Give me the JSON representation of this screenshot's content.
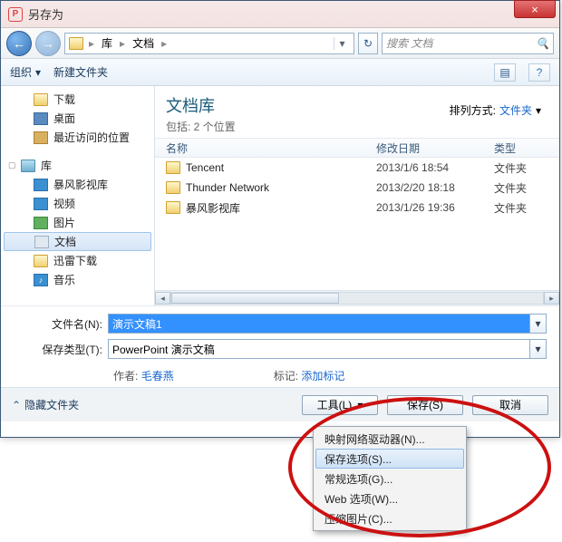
{
  "title": "另存为",
  "close_x": "×",
  "nav": {
    "back": "←",
    "fwd": "→",
    "crumb_lib": "库",
    "crumb_doc": "文档",
    "sep": "▸",
    "refresh": "↻"
  },
  "search": {
    "placeholder": "搜索 文档"
  },
  "toolbar": {
    "organize": "组织",
    "newfolder": "新建文件夹"
  },
  "side": {
    "downloads": "下载",
    "desktop": "桌面",
    "recent": "最近访问的位置",
    "library": "库",
    "baofeng": "暴风影视库",
    "video": "视频",
    "pictures": "图片",
    "documents": "文档",
    "xunlei": "迅雷下载",
    "music": "音乐"
  },
  "lib": {
    "title": "文档库",
    "sub": "包括: 2 个位置",
    "sort_label": "排列方式:",
    "sort_value": "文件夹"
  },
  "cols": {
    "name": "名称",
    "date": "修改日期",
    "type": "类型"
  },
  "files": [
    {
      "name": "Tencent",
      "date": "2013/1/6 18:54",
      "type": "文件夹"
    },
    {
      "name": "Thunder Network",
      "date": "2013/2/20 18:18",
      "type": "文件夹"
    },
    {
      "name": "暴风影视库",
      "date": "2013/1/26 19:36",
      "type": "文件夹"
    }
  ],
  "form": {
    "name_label": "文件名(N):",
    "name_value": "演示文稿1",
    "type_label": "保存类型(T):",
    "type_value": "PowerPoint 演示文稿",
    "author_label": "作者:",
    "author_value": "毛春燕",
    "tag_label": "标记:",
    "tag_value": "添加标记"
  },
  "btns": {
    "hide": "隐藏文件夹",
    "tools": "工具(L)",
    "save": "保存(S)",
    "cancel": "取消"
  },
  "menu": {
    "map": "映射网络驱动器(N)...",
    "saveopt": "保存选项(S)...",
    "general": "常规选项(G)...",
    "web": "Web 选项(W)...",
    "compress": "压缩图片(C)..."
  }
}
